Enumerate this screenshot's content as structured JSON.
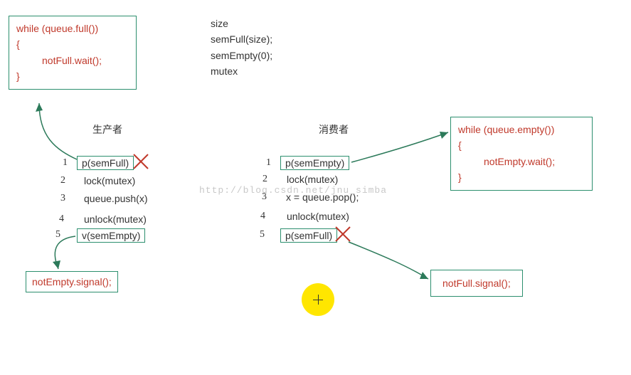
{
  "init_block": {
    "l1": "size",
    "l2": "semFull(size);",
    "l3": "semEmpty(0);",
    "l4": "mutex"
  },
  "producer_box": {
    "l1": "while (queue.full())",
    "l2": "{",
    "l3": "notFull.wait();",
    "l4": "}"
  },
  "consumer_box": {
    "l1": "while (queue.empty())",
    "l2": "{",
    "l3": "notEmpty.wait();",
    "l4": "}"
  },
  "labels": {
    "producer": "生产者",
    "consumer": "消费者"
  },
  "producer_steps": {
    "n1": "1",
    "s1": "p(semFull)",
    "n2": "2",
    "s2": "lock(mutex)",
    "n3": "3",
    "s3": "queue.push(x)",
    "n4": "4",
    "s4": "unlock(mutex)",
    "n5": "5",
    "s5": "v(semEmpty)"
  },
  "consumer_steps": {
    "n1": "1",
    "s1": "p(semEmpty)",
    "n2": "2",
    "s2": "lock(mutex)",
    "n3": "3",
    "s3": "x = queue.pop();",
    "n4": "4",
    "s4": "unlock(mutex)",
    "n5": "5",
    "s5": "p(semFull)"
  },
  "signals": {
    "notEmpty": "notEmpty.signal();",
    "notFull": "notFull.signal();"
  },
  "watermark": "http://blog.csdn.net/jnu_simba"
}
